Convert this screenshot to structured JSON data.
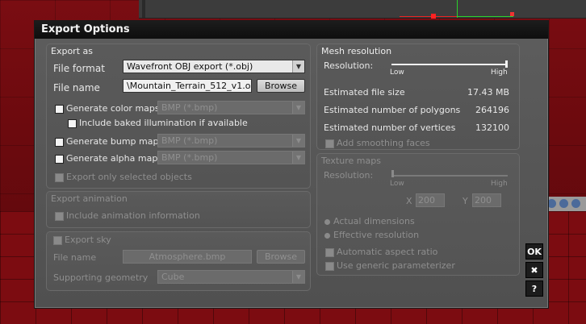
{
  "dialog": {
    "title": "Export Options"
  },
  "export_as": {
    "title": "Export as",
    "file_format_label": "File format",
    "file_format_value": "Wavefront OBJ export (*.obj)",
    "file_name_label": "File name",
    "file_name_value": "\\Mountain_Terrain_512_v1.obj",
    "browse_label": "Browse",
    "gen_color_label": "Generate color maps",
    "gen_color_format": "BMP (*.bmp)",
    "include_baked_label": "Include baked illumination if available",
    "gen_bump_label": "Generate bump maps",
    "gen_bump_format": "BMP (*.bmp)",
    "gen_alpha_label": "Generate alpha maps",
    "gen_alpha_format": "BMP (*.bmp)",
    "export_selected_label": "Export only selected objects"
  },
  "export_animation": {
    "title": "Export animation",
    "include_anim_label": "Include animation information"
  },
  "export_sky": {
    "title": "Export sky",
    "file_name_label": "File name",
    "file_name_value": "Atmosphere.bmp",
    "browse_label": "Browse",
    "supporting_geometry_label": "Supporting geometry",
    "supporting_geometry_value": "Cube"
  },
  "mesh_resolution": {
    "title": "Mesh resolution",
    "resolution_label": "Resolution:",
    "low_label": "Low",
    "high_label": "High",
    "resolution_level": 1.0,
    "est_file_size_label": "Estimated file size",
    "est_file_size_value": "17.43 MB",
    "est_polygons_label": "Estimated number of polygons",
    "est_polygons_value": "264196",
    "est_vertices_label": "Estimated number of vertices",
    "est_vertices_value": "132100",
    "add_smoothing_label": "Add smoothing faces"
  },
  "texture_maps": {
    "title": "Texture maps",
    "resolution_label": "Resolution:",
    "low_label": "Low",
    "high_label": "High",
    "resolution_level": 0.0,
    "x_label": "X",
    "x_value": "200",
    "y_label": "Y",
    "y_value": "200",
    "actual_dimensions_label": "Actual dimensions",
    "effective_resolution_label": "Effective resolution",
    "auto_aspect_label": "Automatic aspect ratio",
    "generic_param_label": "Use generic parameterizer"
  },
  "side_buttons": {
    "ok": "OK",
    "cancel": "✖",
    "help": "?"
  }
}
